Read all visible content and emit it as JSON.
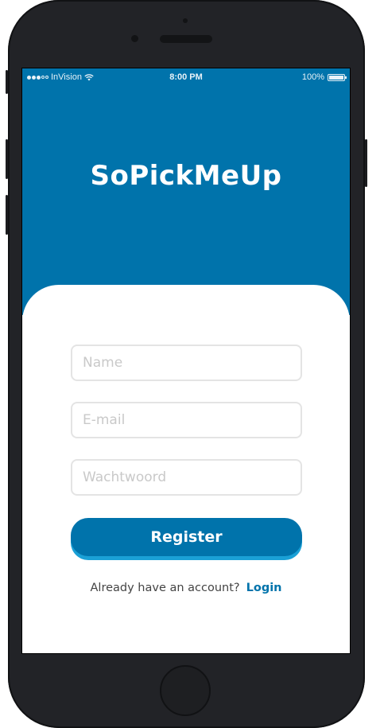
{
  "status_bar": {
    "carrier": "InVision",
    "time": "8:00 PM",
    "battery": "100%"
  },
  "app": {
    "title": "SoPickMeUp"
  },
  "form": {
    "name_placeholder": "Name",
    "email_placeholder": "E-mail",
    "password_placeholder": "Wachtwoord",
    "register_label": "Register"
  },
  "footer": {
    "prompt": "Already have an account?",
    "login_label": "Login"
  },
  "colors": {
    "brand": "#0073ab",
    "button_shadow": "#1aa0d6",
    "input_border": "#e4e4e4"
  },
  "icons": {
    "signal": "signal-dots-icon",
    "wifi": "wifi-icon",
    "battery": "battery-icon"
  }
}
